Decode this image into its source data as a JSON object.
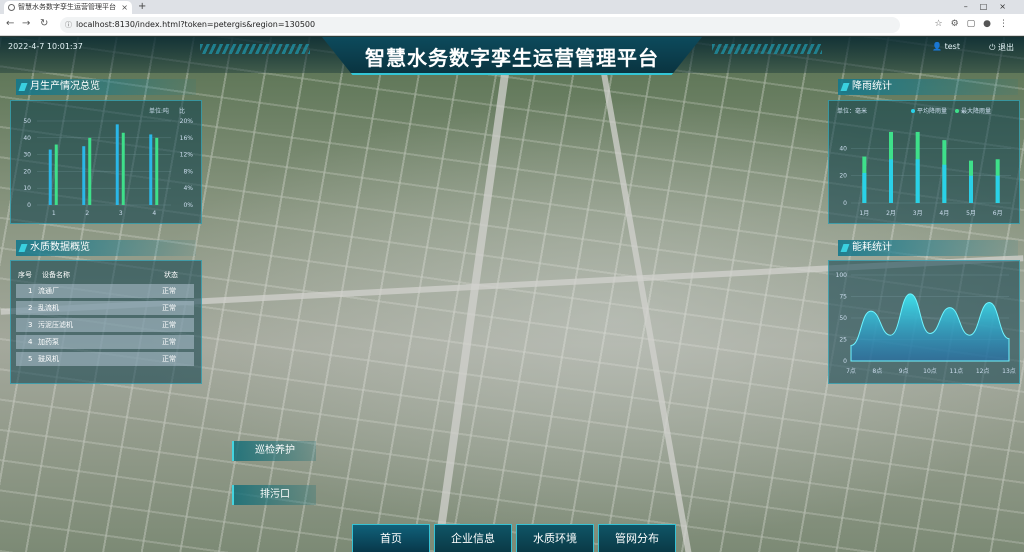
{
  "browser": {
    "tab_title": "智慧水务数字孪生运营管理平台",
    "url": "localhost:8130/index.html?token=petergis&region=130500"
  },
  "header": {
    "title": "智慧水务数字孪生运营管理平台",
    "datetime": "2022-4-7 10:01:37",
    "user": "test",
    "logout": "退出"
  },
  "panels": {
    "production": {
      "title": "月生产情况总览",
      "legend_left": "单位:吨",
      "legend_right": "比",
      "chart_data": {
        "type": "bar",
        "categories": [
          "1",
          "2",
          "3",
          "4"
        ],
        "series": [
          {
            "values": [
              33,
              35,
              48,
              42
            ]
          },
          {
            "values": [
              36,
              40,
              43,
              40
            ]
          }
        ],
        "ylim": [
          0,
          50
        ],
        "y_ticks": [
          "0",
          "10",
          "20",
          "30",
          "40",
          "50"
        ],
        "y2_ticks": [
          "0%",
          "4%",
          "8%",
          "12%",
          "16%",
          "20%"
        ]
      }
    },
    "water_quality": {
      "title": "水质数据概览",
      "headers": [
        "序号",
        "设备名称",
        "状态"
      ],
      "rows": [
        {
          "no": "1",
          "name": "流通厂",
          "status": "正常"
        },
        {
          "no": "2",
          "name": "乱流机",
          "status": "正常"
        },
        {
          "no": "3",
          "name": "污泥压滤机",
          "status": "正常"
        },
        {
          "no": "4",
          "name": "加药泵",
          "status": "正常"
        },
        {
          "no": "5",
          "name": "鼓风机",
          "status": "正常"
        }
      ]
    },
    "rainfall": {
      "title": "降雨统计",
      "unit": "单位：毫米",
      "legend": [
        "平均降雨量",
        "最大降雨量"
      ],
      "chart_data": {
        "type": "bar",
        "categories": [
          "1月",
          "2月",
          "3月",
          "4月",
          "5月",
          "6月"
        ],
        "series": [
          {
            "name": "平均降雨量",
            "values": [
              22,
              32,
              32,
              28,
              20,
              20
            ]
          },
          {
            "name": "最大降雨量",
            "values": [
              34,
              52,
              52,
              46,
              31,
              32
            ]
          }
        ],
        "ylim": [
          0,
          60
        ],
        "y_ticks": [
          "0",
          "20",
          "40"
        ]
      }
    },
    "energy": {
      "title": "能耗统计",
      "chart_data": {
        "type": "area",
        "categories": [
          "7点",
          "8点",
          "9点",
          "10点",
          "11点",
          "12点",
          "13点"
        ],
        "values": [
          18,
          58,
          30,
          78,
          32,
          62,
          30,
          68,
          26
        ],
        "ylim": [
          0,
          100
        ],
        "y_ticks": [
          "0",
          "25",
          "50",
          "75",
          "100"
        ]
      }
    }
  },
  "float_buttons": [
    "巡检养护",
    "排污口"
  ],
  "nav": [
    "首页",
    "企业信息",
    "水质环境",
    "管网分布"
  ],
  "colors": {
    "accent": "#36c2d4",
    "bar_cyan": "#2ad1e8",
    "bar_green": "#3ee08a",
    "header_bg": "#0a3440"
  }
}
